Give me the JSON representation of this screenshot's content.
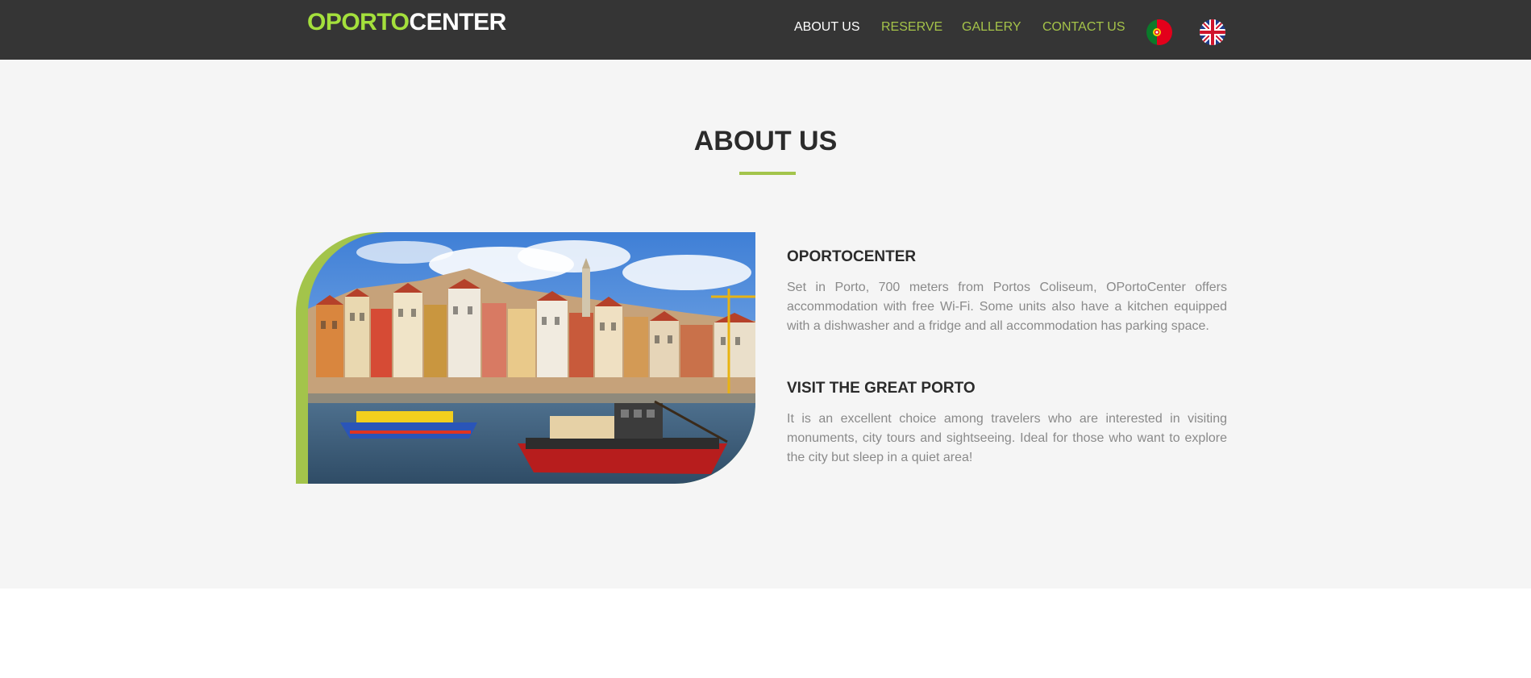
{
  "header": {
    "logo_part1": "OPORTO",
    "logo_part2": "CENTER",
    "nav": [
      {
        "label": "ABOUT US",
        "active": true
      },
      {
        "label": "RESERVE",
        "active": false
      },
      {
        "label": "GALLERY",
        "active": false
      },
      {
        "label": "CONTACT US",
        "active": false
      }
    ],
    "languages": [
      {
        "icon": "portugal-flag-icon"
      },
      {
        "icon": "uk-flag-icon"
      }
    ]
  },
  "about": {
    "title": "ABOUT US",
    "image": "porto-riverside-photo",
    "blocks": [
      {
        "heading": "OPORTOCENTER",
        "text": "Set in Porto, 700 meters from Portos Coliseum, OPortoCenter offers accommodation with free Wi-Fi. Some units also have a kitchen equipped with a dishwasher and a fridge and all accommodation has parking space."
      },
      {
        "heading": "VISIT THE GREAT PORTO",
        "text": "It is an excellent choice among travelers who are interested in visiting monuments, city tours and sightseeing. Ideal for those who want to explore the city but sleep in a quiet area!"
      }
    ]
  },
  "colors": {
    "header_bg": "#353535",
    "accent": "#a3c44b",
    "logo_green": "#a4e03c",
    "section_bg": "#f5f5f5"
  }
}
